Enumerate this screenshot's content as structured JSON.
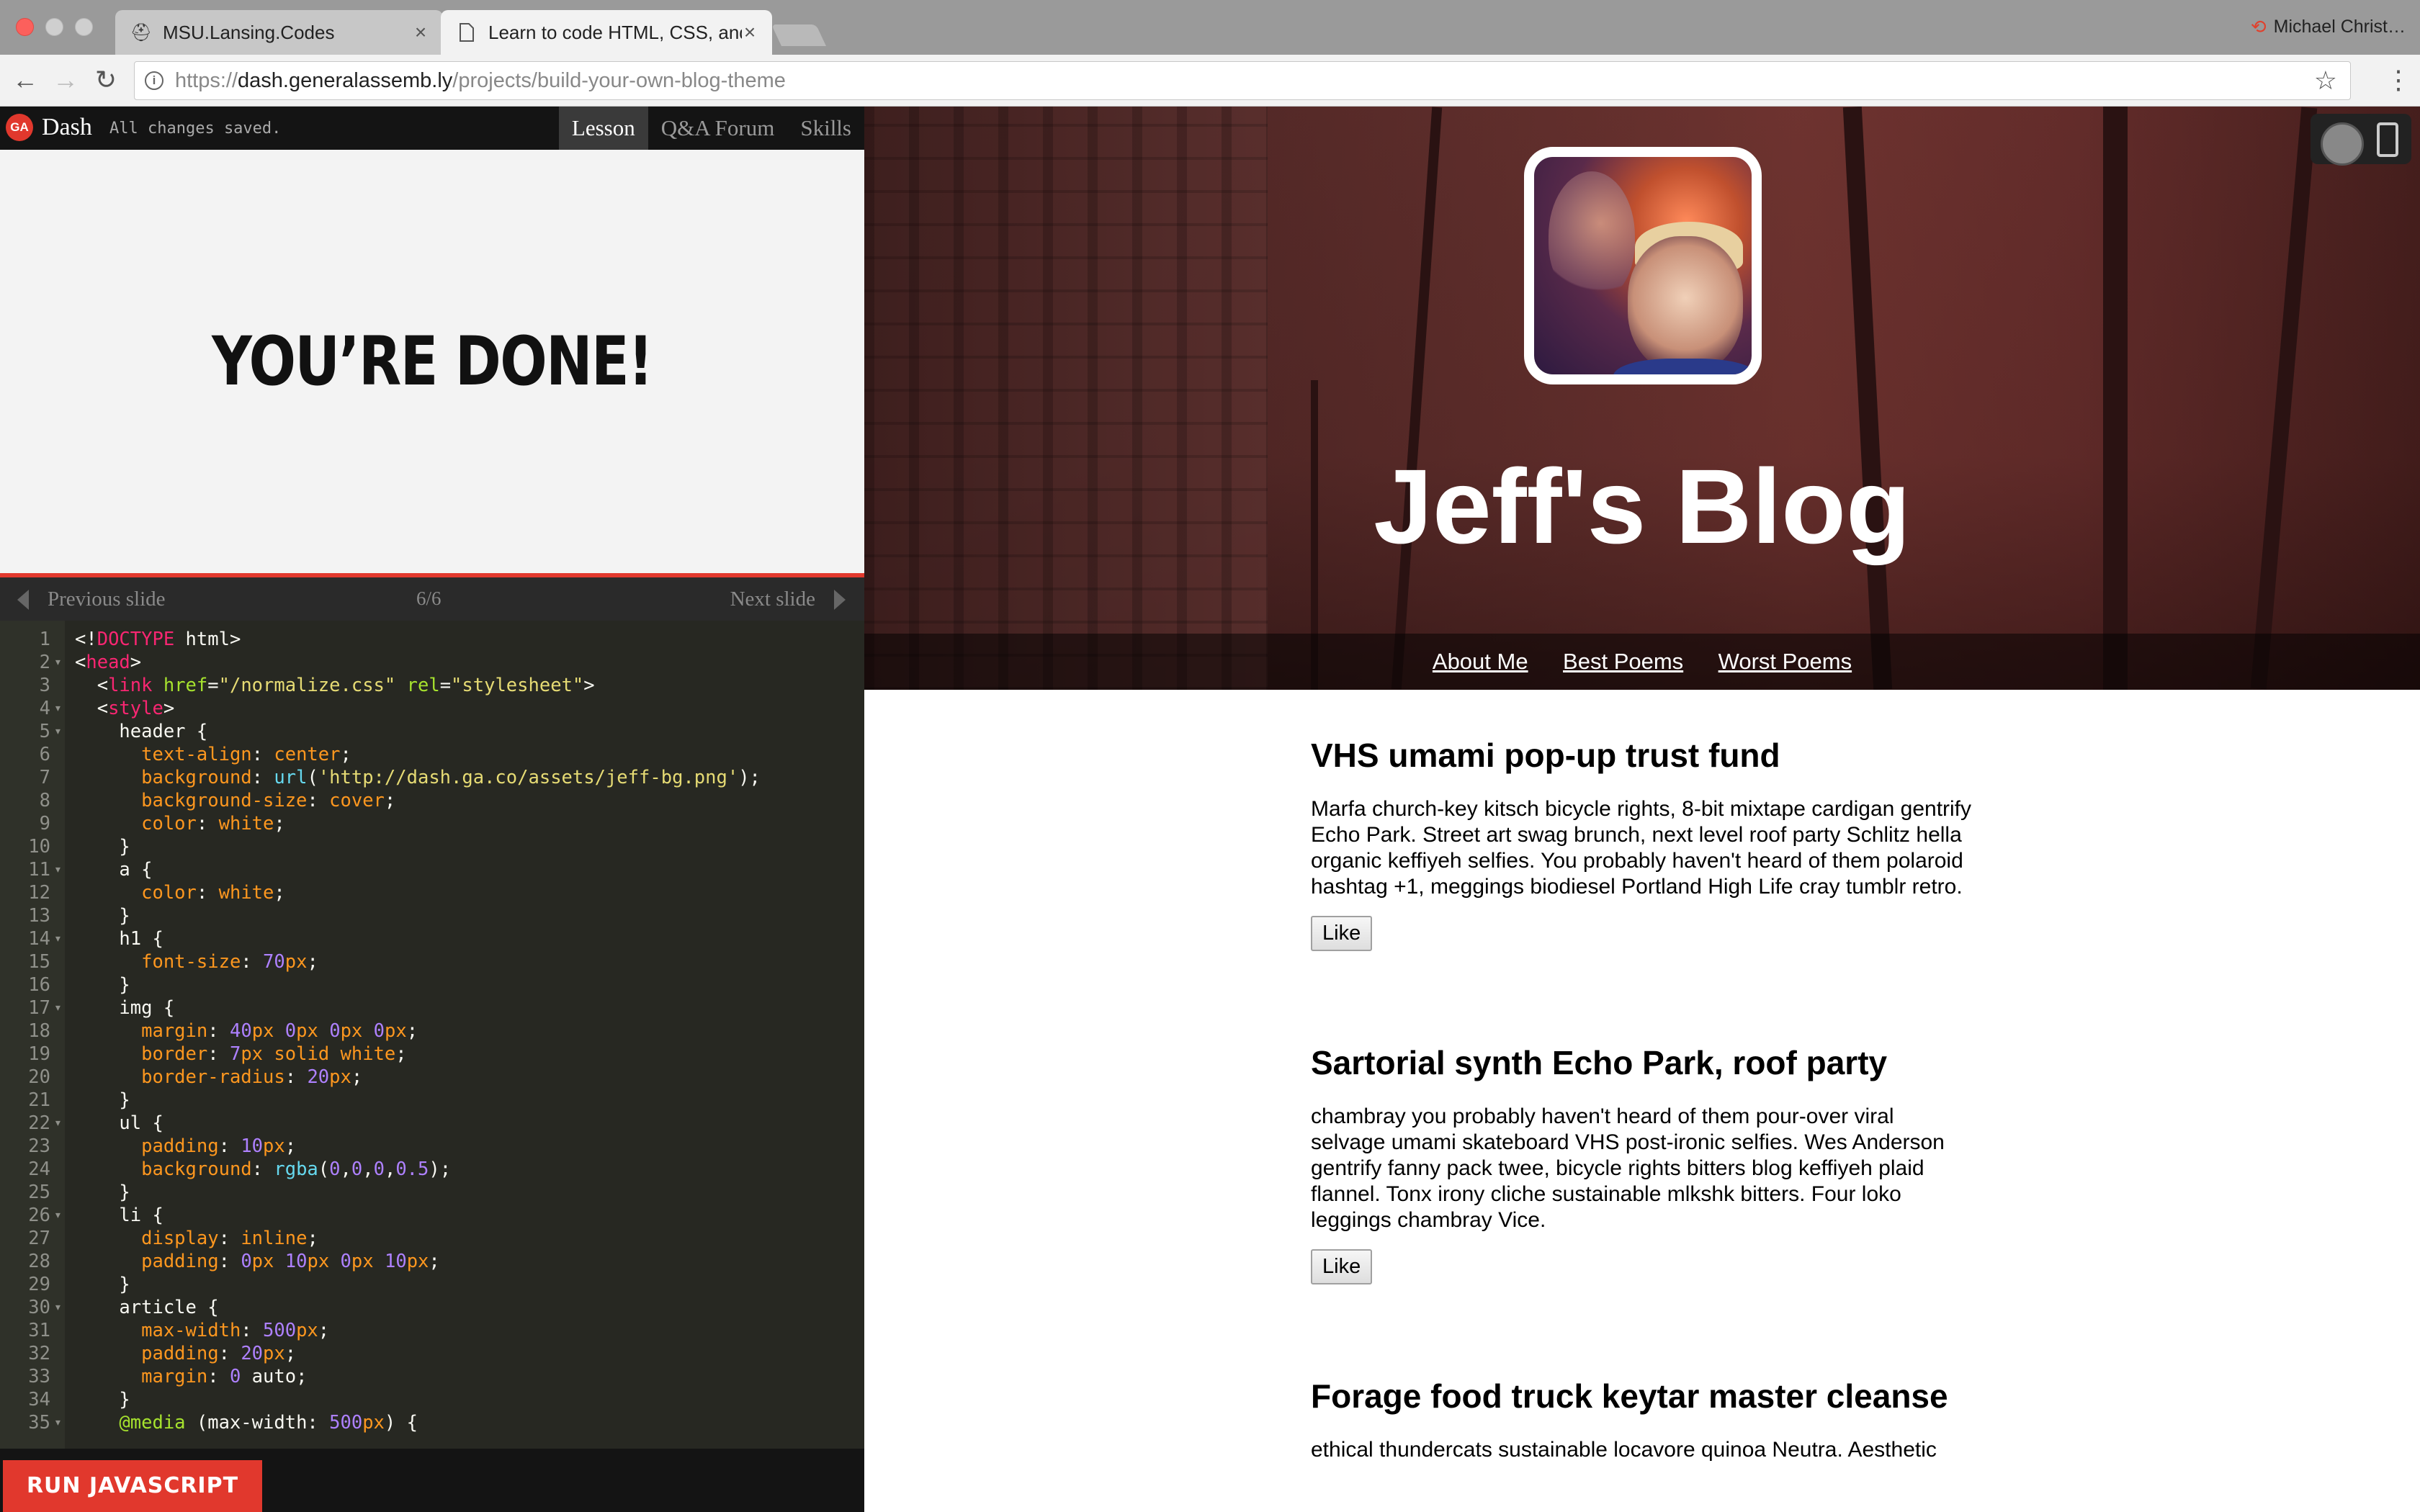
{
  "browser": {
    "tabs": [
      {
        "title": "MSU.Lansing.Codes",
        "favicon": "spartan-icon"
      },
      {
        "title": "Learn to code HTML, CSS, and",
        "favicon": "page-icon"
      }
    ],
    "profile_name": "Michael Christ…",
    "url_scheme": "https://",
    "url_host": "dash.generalassemb.ly",
    "url_path": "/projects/build-your-own-blog-theme"
  },
  "dash": {
    "logo": "GA",
    "title": "Dash",
    "status": "All changes saved.",
    "tabs": [
      "Lesson",
      "Q&A Forum",
      "Skills"
    ],
    "active_tab": "Lesson",
    "slide_text": "YOU’RE DONE!",
    "prev_label": "Previous slide",
    "next_label": "Next slide",
    "slide_count": "6/6",
    "run_label": "RUN JAVASCRIPT"
  },
  "code_lines": [
    "<!DOCTYPE html>",
    "<head>",
    "  <link href=\"/normalize.css\" rel=\"stylesheet\">",
    "  <style>",
    "    header {",
    "      text-align: center;",
    "      background: url('http://dash.ga.co/assets/jeff-bg.png');",
    "      background-size: cover;",
    "      color: white;",
    "    }",
    "    a {",
    "      color: white;",
    "    }",
    "    h1 {",
    "      font-size: 70px;",
    "    }",
    "    img {",
    "      margin: 40px 0px 0px 0px;",
    "      border: 7px solid white;",
    "      border-radius: 20px;",
    "    }",
    "    ul {",
    "      padding: 10px;",
    "      background: rgba(0,0,0,0.5);",
    "    }",
    "    li {",
    "      display: inline;",
    "      padding: 0px 10px 0px 10px;",
    "    }",
    "    article {",
    "      max-width: 500px;",
    "      padding: 20px;",
    "      margin: 0 auto;",
    "    }",
    "    @media (max-width: 500px) {"
  ],
  "preview": {
    "blog_title": "Jeff's Blog",
    "nav": [
      "About Me",
      "Best Poems",
      "Worst Poems"
    ],
    "articles": [
      {
        "title": "VHS umami pop-up trust fund",
        "body": "Marfa church-key kitsch bicycle rights, 8-bit mixtape cardigan gentrify Echo Park. Street art swag brunch, next level roof party Schlitz hella organic keffiyeh selfies. You probably haven't heard of them polaroid hashtag +1, meggings biodiesel Portland High Life cray tumblr retro.",
        "like": "Like"
      },
      {
        "title": "Sartorial synth Echo Park, roof party",
        "body": "chambray you probably haven't heard of them pour-over viral selvage umami skateboard VHS post-ironic selfies. Wes Anderson gentrify fanny pack twee, bicycle rights bitters blog keffiyeh plaid flannel. Tonx irony cliche sustainable mlkshk bitters. Four loko leggings chambray Vice.",
        "like": "Like"
      },
      {
        "title": "Forage food truck keytar master cleanse",
        "body": "ethical thundercats sustainable locavore quinoa Neutra. Aesthetic",
        "like": ""
      }
    ]
  }
}
